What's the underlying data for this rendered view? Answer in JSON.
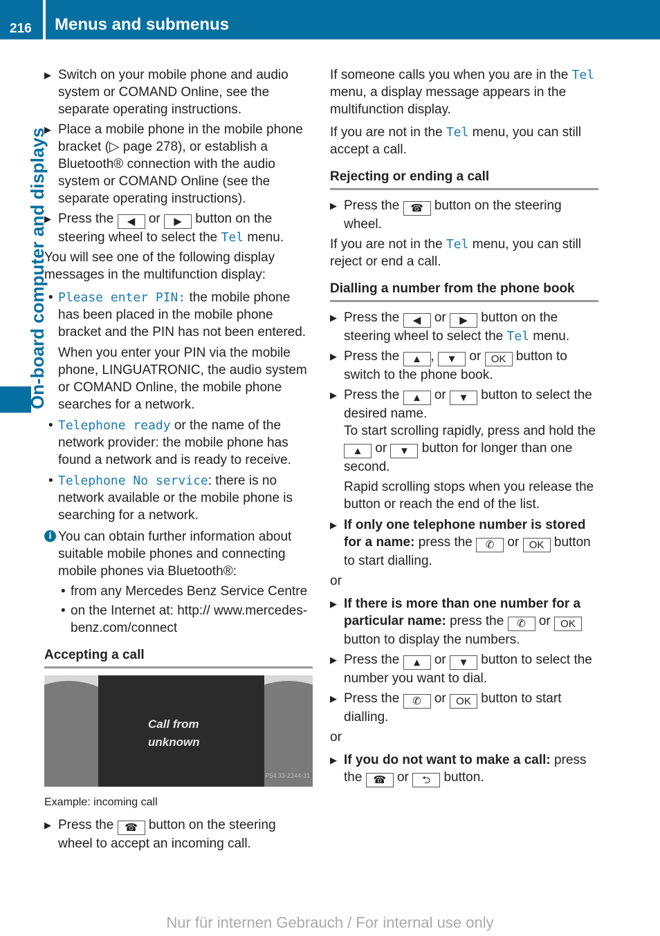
{
  "header": {
    "page_number": "216",
    "title": "Menus and submenus"
  },
  "side_tab": "On-board computer and displays",
  "left": {
    "steps1": [
      "Switch on your mobile phone and audio system or COMAND Online, see the separate operating instructions.",
      "Place a mobile phone in the mobile phone bracket (▷ page 278), or establish a Bluetooth® connection with the audio system or COMAND Online (see the separate operating instructions)."
    ],
    "step3": {
      "pre": "Press the",
      "k1": "◀",
      "or": "or",
      "k2": "▶",
      "mid": "button on the steering wheel to select the",
      "menu": "Tel",
      "post": "menu."
    },
    "intro": "You will see one of the following display messages in the multifunction display:",
    "messages": [
      {
        "code": "Please enter PIN:",
        "text": " the mobile phone has been placed in the mobile phone bracket and the PIN has not been entered."
      },
      {
        "code": "Telephone ready",
        "text": " or the name of the network provider: the mobile phone has found a network and is ready to receive."
      },
      {
        "code": "Telephone No service",
        "text": ": there is no network available or the mobile phone is searching for a network."
      }
    ],
    "pin_note": "When you enter your PIN via the mobile phone, LINGUATRONIC, the audio system or COMAND Online, the mobile phone searches for a network.",
    "info": {
      "text": "You can obtain further information about suitable mobile phones and connecting mobile phones via Bluetooth®:",
      "items": [
        "from any Mercedes Benz Service Centre",
        "on the Internet at: http:// www.mercedes-benz.com/connect"
      ]
    },
    "accept_heading": "Accepting a call",
    "figure": {
      "line1": "Call from",
      "line2": "unknown",
      "code": "P54.33-2244-31",
      "caption": "Example: incoming call"
    },
    "accept_step": {
      "pre": "Press the",
      "key": "☎",
      "post": "button on the steering wheel to accept an incoming call."
    }
  },
  "right": {
    "p1_pre": "If someone calls you when you are in the",
    "menu": "Tel",
    "p1_post": "menu, a display message appears in the multifunction display.",
    "p2_pre": "If you are not in the",
    "p2_post": "menu, you can still accept a call.",
    "reject_heading": "Rejecting or ending a call",
    "reject_step": {
      "pre": "Press the",
      "key": "☎",
      "post": "button on the steering wheel."
    },
    "p3_pre": "If you are not in the",
    "p3_post": "menu, you can still reject or end a call.",
    "dial_heading": "Dialling a number from the phone book",
    "or": "or",
    "s1": {
      "pre": "Press the",
      "k1": "◀",
      "k2": "▶",
      "mid": "button on the steering wheel to select the",
      "post": "menu."
    },
    "s2": {
      "pre": "Press the",
      "k1": "▲",
      "k2": "▼",
      "k3": "OK",
      "post": "button to switch to the phone book."
    },
    "s3": {
      "pre": "Press the",
      "k1": "▲",
      "k2": "▼",
      "post": "button to select the desired name.",
      "extra_pre": "To start scrolling rapidly, press and hold the",
      "extra_post": "button for longer than one second.",
      "note": "Rapid scrolling stops when you release the button or reach the end of the list."
    },
    "s4": {
      "bold": "If only one telephone number is stored for a name:",
      "pre": "press the",
      "key": "✆",
      "k2": "OK",
      "post": "button to start dialling."
    },
    "s5": {
      "bold": "If there is more than one number for a particular name:",
      "pre": "press the",
      "key": "✆",
      "k2": "OK",
      "post": "button to display the numbers."
    },
    "s6": {
      "pre": "Press the",
      "k1": "▲",
      "k2": "▼",
      "post": "button to select the number you want to dial."
    },
    "s7": {
      "pre": "Press the",
      "key": "✆",
      "k2": "OK",
      "post": "button to start dialling."
    },
    "s8": {
      "bold": "If you do not want to make a call:",
      "pre": "press the",
      "key": "☎",
      "k2": "⮌",
      "post": "button."
    }
  },
  "footer": "Nur für internen Gebrauch / For internal use only"
}
